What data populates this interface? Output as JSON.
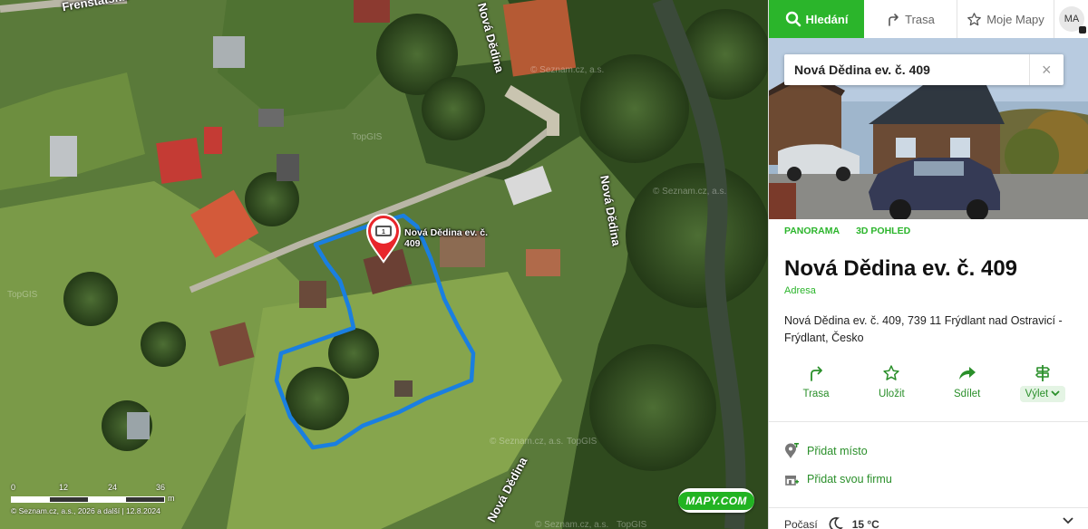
{
  "map": {
    "road_labels": [
      "Frenštátská",
      "Nová Dědina",
      "Nová Dědina",
      "Nová Dědina"
    ],
    "watermarks": [
      "© Seznam.cz, a.s.",
      "TopGIS",
      "© Seznam.cz, a.s.",
      "TopGIS",
      "© Seznam.cz, a.s.",
      "TopGIS",
      "© Seznam.cz, a.s.",
      "TopGIS"
    ],
    "pin": {
      "badge": "1",
      "label": "Nová Dědina ev. č. 409",
      "icon": "photo-icon",
      "color": "#e8262b"
    },
    "boundary_color": "#1a7fe0",
    "scale": {
      "ticks": [
        "0",
        "12",
        "24",
        "36"
      ],
      "unit": "m"
    },
    "copyright": "© Seznam.cz, a.s., 2026 a další | 12.8.2024",
    "logo": "MAPY.COM"
  },
  "panel": {
    "nav": {
      "search": "Hledání",
      "route": "Trasa",
      "my_maps": "Moje Mapy",
      "avatar": "MA"
    },
    "search": {
      "value": "Nová Dědina ev. č. 409",
      "close": "×"
    },
    "view_tabs": [
      "PANORAMA",
      "3D POHLED"
    ],
    "title": "Nová Dědina ev. č. 409",
    "type": "Adresa",
    "address": "Nová Dědina ev. č. 409, 739 11 Frýdlant nad Ostravicí - Frýdlant, Česko",
    "actions": [
      {
        "label": "Trasa",
        "icon": "route-icon"
      },
      {
        "label": "Uložit",
        "icon": "star-icon"
      },
      {
        "label": "Sdílet",
        "icon": "share-icon"
      },
      {
        "label": "Výlet",
        "icon": "signpost-icon"
      }
    ],
    "links": [
      {
        "label": "Přidat místo",
        "icon": "add-place-icon"
      },
      {
        "label": "Přidat svou firmu",
        "icon": "add-business-icon"
      }
    ],
    "weather": {
      "label": "Počasí",
      "temp": "15 °C",
      "icon": "moon-icon"
    },
    "accent": "#2bb52b"
  }
}
